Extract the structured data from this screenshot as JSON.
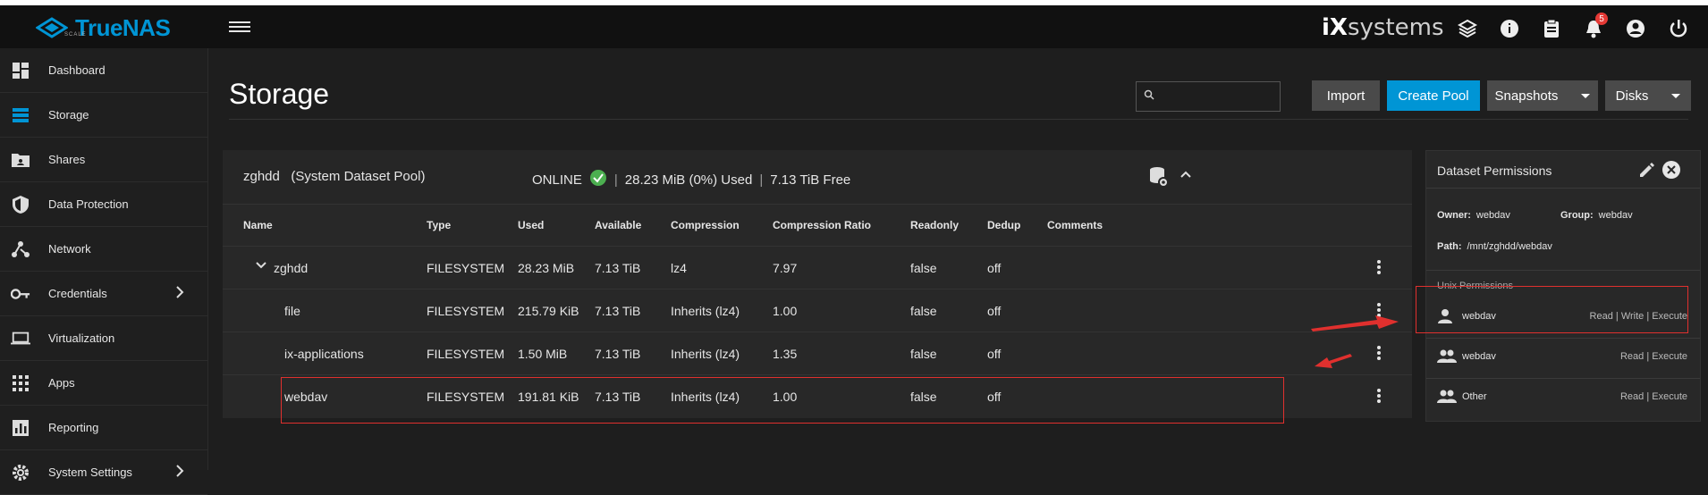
{
  "topbar": {
    "logo_text": "TrueNAS",
    "logo_sub": "SCALE",
    "brand_prefix": "iX",
    "brand_suffix": "systems",
    "notification_count": "5",
    "icons": [
      "truecommand-icon",
      "info-icon",
      "clipboard-icon",
      "bell-icon",
      "account-icon",
      "power-icon"
    ]
  },
  "sidebar": {
    "items": [
      {
        "label": "Dashboard",
        "icon": "dashboard-icon"
      },
      {
        "label": "Storage",
        "icon": "storage-icon",
        "active": true
      },
      {
        "label": "Shares",
        "icon": "folder-share-icon"
      },
      {
        "label": "Data Protection",
        "icon": "shield-icon"
      },
      {
        "label": "Network",
        "icon": "network-icon"
      },
      {
        "label": "Credentials",
        "icon": "key-icon",
        "expandable": true
      },
      {
        "label": "Virtualization",
        "icon": "laptop-icon"
      },
      {
        "label": "Apps",
        "icon": "apps-grid-icon"
      },
      {
        "label": "Reporting",
        "icon": "chart-icon"
      },
      {
        "label": "System Settings",
        "icon": "gear-icon",
        "expandable": true
      }
    ]
  },
  "page": {
    "title": "Storage",
    "search_placeholder": "",
    "buttons": {
      "import": "Import",
      "create_pool": "Create Pool",
      "snapshots": "Snapshots",
      "disks": "Disks"
    }
  },
  "pool": {
    "name": "zghdd",
    "note": "(System Dataset Pool)",
    "status": "ONLINE",
    "used": "28.23 MiB (0%) Used",
    "free": "7.13 TiB Free"
  },
  "table": {
    "columns": [
      "Name",
      "Type",
      "Used",
      "Available",
      "Compression",
      "Compression Ratio",
      "Readonly",
      "Dedup",
      "Comments"
    ],
    "rows": [
      {
        "name": "zghdd",
        "type": "FILESYSTEM",
        "used": "28.23 MiB",
        "available": "7.13 TiB",
        "compression": "lz4",
        "ratio": "7.97",
        "readonly": "false",
        "dedup": "off",
        "comments": ""
      },
      {
        "name": "file",
        "type": "FILESYSTEM",
        "used": "215.79 KiB",
        "available": "7.13 TiB",
        "compression": "Inherits (lz4)",
        "ratio": "1.00",
        "readonly": "false",
        "dedup": "off",
        "comments": ""
      },
      {
        "name": "ix-applications",
        "type": "FILESYSTEM",
        "used": "1.50 MiB",
        "available": "7.13 TiB",
        "compression": "Inherits (lz4)",
        "ratio": "1.35",
        "readonly": "false",
        "dedup": "off",
        "comments": ""
      },
      {
        "name": "webdav",
        "type": "FILESYSTEM",
        "used": "191.81 KiB",
        "available": "7.13 TiB",
        "compression": "Inherits (lz4)",
        "ratio": "1.00",
        "readonly": "false",
        "dedup": "off",
        "comments": ""
      }
    ]
  },
  "permissions": {
    "title": "Dataset Permissions",
    "owner_label": "Owner:",
    "owner": "webdav",
    "group_label": "Group:",
    "group": "webdav",
    "path_label": "Path:",
    "path": "/mnt/zghdd/webdav",
    "unix_label": "Unix Permissions",
    "entries": [
      {
        "name": "webdav",
        "rights": "Read | Write | Execute",
        "icon": "user-icon"
      },
      {
        "name": "webdav",
        "rights": "Read | Execute",
        "icon": "group-icon"
      },
      {
        "name": "Other",
        "rights": "Read | Execute",
        "icon": "group-icon"
      }
    ]
  },
  "colors": {
    "accent": "#0095d5",
    "online": "#4caf50",
    "highlight": "#e0302e",
    "badge": "#e53935"
  }
}
